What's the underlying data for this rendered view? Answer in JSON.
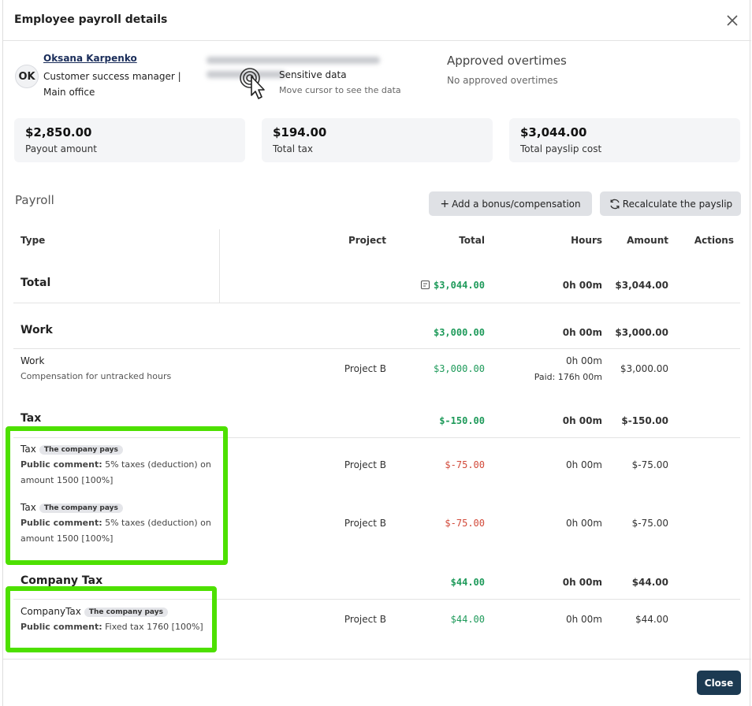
{
  "dialog": {
    "title": "Employee payroll details",
    "close_button": "Close"
  },
  "employee": {
    "initials": "OK",
    "name": "Oksana Karpenko",
    "role_line1": "Customer success manager |",
    "role_line2": "Main office"
  },
  "sensitive": {
    "title": "Sensitive data",
    "subtitle": "Move cursor to see the data"
  },
  "overtimes": {
    "title": "Approved overtimes",
    "value": "No approved overtimes"
  },
  "summary": [
    {
      "amount": "$2,850.00",
      "label": "Payout amount"
    },
    {
      "amount": "$194.00",
      "label": "Total tax"
    },
    {
      "amount": "$3,044.00",
      "label": "Total payslip cost"
    }
  ],
  "payroll": {
    "title": "Payroll",
    "add_bonus_label": "Add a bonus/compensation",
    "recalc_label": "Recalculate the payslip",
    "columns": {
      "type": "Type",
      "project": "Project",
      "total": "Total",
      "hours": "Hours",
      "amount": "Amount",
      "actions": "Actions"
    },
    "total_row": {
      "type": "Total",
      "total": "$3,044.00",
      "hours": "0h 00m",
      "amount": "$3,044.00"
    },
    "work_group": {
      "type": "Work",
      "total": "$3,000.00",
      "hours": "0h 00m",
      "amount": "$3,000.00"
    },
    "work_item": {
      "type": "Work",
      "description": "Compensation for untracked hours",
      "project": "Project B",
      "total": "$3,000.00",
      "hours": "0h 00m",
      "paid": "Paid: 176h 00m",
      "amount": "$3,000.00"
    },
    "tax_group": {
      "type": "Tax",
      "total": "$-150.00",
      "hours": "0h 00m",
      "amount": "$-150.00"
    },
    "tax_items": [
      {
        "type": "Tax",
        "badge": "The company pays",
        "comment_label": "Public comment:",
        "comment_line1": "5% taxes (deduction) on",
        "comment_line2": "amount 1500 [100%]",
        "project": "Project B",
        "total": "$-75.00",
        "hours": "0h 00m",
        "amount": "$-75.00"
      },
      {
        "type": "Tax",
        "badge": "The company pays",
        "comment_label": "Public comment:",
        "comment_line1": "5% taxes (deduction) on",
        "comment_line2": "amount 1500 [100%]",
        "project": "Project B",
        "total": "$-75.00",
        "hours": "0h 00m",
        "amount": "$-75.00"
      }
    ],
    "company_tax_group": {
      "type": "Company Tax",
      "total": "$44.00",
      "hours": "0h 00m",
      "amount": "$44.00"
    },
    "company_tax_item": {
      "type": "CompanyTax",
      "badge": "The company pays",
      "comment_label": "Public comment:",
      "comment": "Fixed tax 1760 [100%]",
      "project": "Project B",
      "total": "$44.00",
      "hours": "0h 00m",
      "amount": "$44.00"
    }
  },
  "colors": {
    "highlight": "#4de000",
    "positive": "#1e9a5a",
    "negative": "#d24a3a",
    "primary_button": "#1c3a52"
  }
}
